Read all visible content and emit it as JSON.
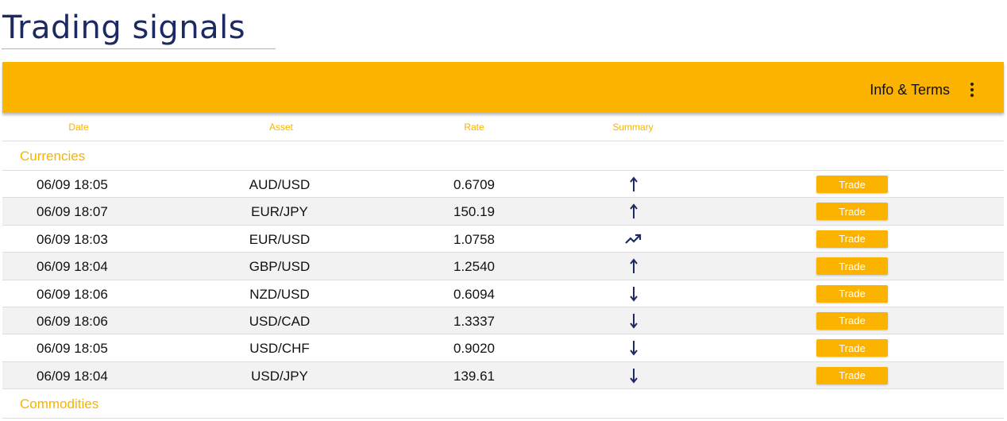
{
  "page": {
    "title": "Trading signals"
  },
  "toolbar": {
    "info_label": "Info & Terms",
    "menu_icon": "kebab-menu-icon"
  },
  "colors": {
    "accent": "#fcb300",
    "title": "#1d2a62",
    "row_alt": "#f2f2f2"
  },
  "table": {
    "columns": [
      "Date",
      "Asset",
      "Rate",
      "Summary"
    ],
    "groups": [
      {
        "name": "Currencies",
        "rows": [
          {
            "date": "06/09 18:05",
            "asset": "AUD/USD",
            "rate": "0.6709",
            "summary": "arrow-up",
            "action": "Trade"
          },
          {
            "date": "06/09 18:07",
            "asset": "EUR/JPY",
            "rate": "150.19",
            "summary": "arrow-up",
            "action": "Trade"
          },
          {
            "date": "06/09 18:03",
            "asset": "EUR/USD",
            "rate": "1.0758",
            "summary": "trending-up",
            "action": "Trade"
          },
          {
            "date": "06/09 18:04",
            "asset": "GBP/USD",
            "rate": "1.2540",
            "summary": "arrow-up",
            "action": "Trade"
          },
          {
            "date": "06/09 18:06",
            "asset": "NZD/USD",
            "rate": "0.6094",
            "summary": "arrow-down",
            "action": "Trade"
          },
          {
            "date": "06/09 18:06",
            "asset": "USD/CAD",
            "rate": "1.3337",
            "summary": "arrow-down",
            "action": "Trade"
          },
          {
            "date": "06/09 18:05",
            "asset": "USD/CHF",
            "rate": "0.9020",
            "summary": "arrow-down",
            "action": "Trade"
          },
          {
            "date": "06/09 18:04",
            "asset": "USD/JPY",
            "rate": "139.61",
            "summary": "arrow-down",
            "action": "Trade"
          }
        ]
      },
      {
        "name": "Commodities",
        "rows": []
      }
    ]
  }
}
